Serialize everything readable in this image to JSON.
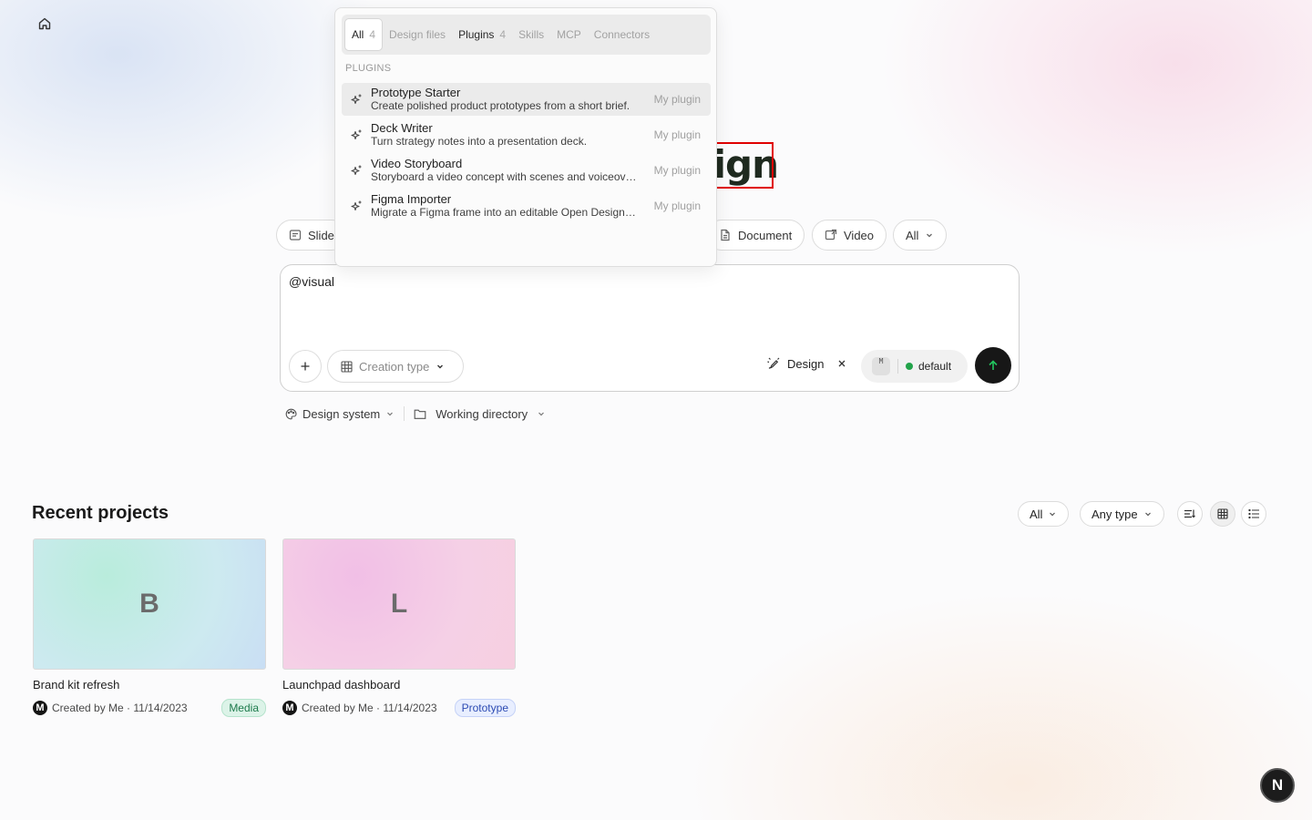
{
  "hero": {
    "title_fragment": "sign"
  },
  "type_chips": {
    "slide": "Slide",
    "document": "Document",
    "video": "Video",
    "all": "All"
  },
  "composer": {
    "text": "@visual",
    "creation_type_placeholder": "Creation type",
    "design_tag": "Design",
    "model_initial": "M",
    "model_name": "default"
  },
  "below_composer": {
    "design_system": "Design system",
    "working_directory": "Working directory"
  },
  "popover": {
    "tabs": [
      {
        "label": "All",
        "count": "4"
      },
      {
        "label": "Design files",
        "count": ""
      },
      {
        "label": "Plugins",
        "count": "4"
      },
      {
        "label": "Skills",
        "count": ""
      },
      {
        "label": "MCP",
        "count": ""
      },
      {
        "label": "Connectors",
        "count": ""
      }
    ],
    "section_label": "PLUGINS",
    "items": [
      {
        "title": "Prototype Starter",
        "desc": "Create polished product prototypes from a short brief.",
        "tag": "My plugin"
      },
      {
        "title": "Deck Writer",
        "desc": "Turn strategy notes into a presentation deck.",
        "tag": "My plugin"
      },
      {
        "title": "Video Storyboard",
        "desc": "Storyboard a video concept with scenes and voiceover.",
        "tag": "My plugin"
      },
      {
        "title": "Figma Importer",
        "desc": "Migrate a Figma frame into an editable Open Design file.",
        "tag": "My plugin"
      }
    ]
  },
  "recent": {
    "title": "Recent projects",
    "filter_all": "All",
    "filter_type": "Any type",
    "projects": [
      {
        "letter": "B",
        "name": "Brand kit refresh",
        "avatar": "M",
        "meta": "Created by Me · 11/14/2023",
        "badge": "Media"
      },
      {
        "letter": "L",
        "name": "Launchpad dashboard",
        "avatar": "M",
        "meta": "Created by Me · 11/14/2023",
        "badge": "Prototype"
      }
    ]
  },
  "fab": {
    "label": "N"
  },
  "colors": {
    "send_button": "#171717",
    "status_dot": "#22a34a",
    "highlight_box": "#e00000"
  },
  "icons": {
    "home": "home-icon",
    "sparkle": "sparkle-icon",
    "send": "arrow-up-icon",
    "grid": "grid-view-icon",
    "list": "list-view-icon",
    "sort": "sort-icon"
  }
}
